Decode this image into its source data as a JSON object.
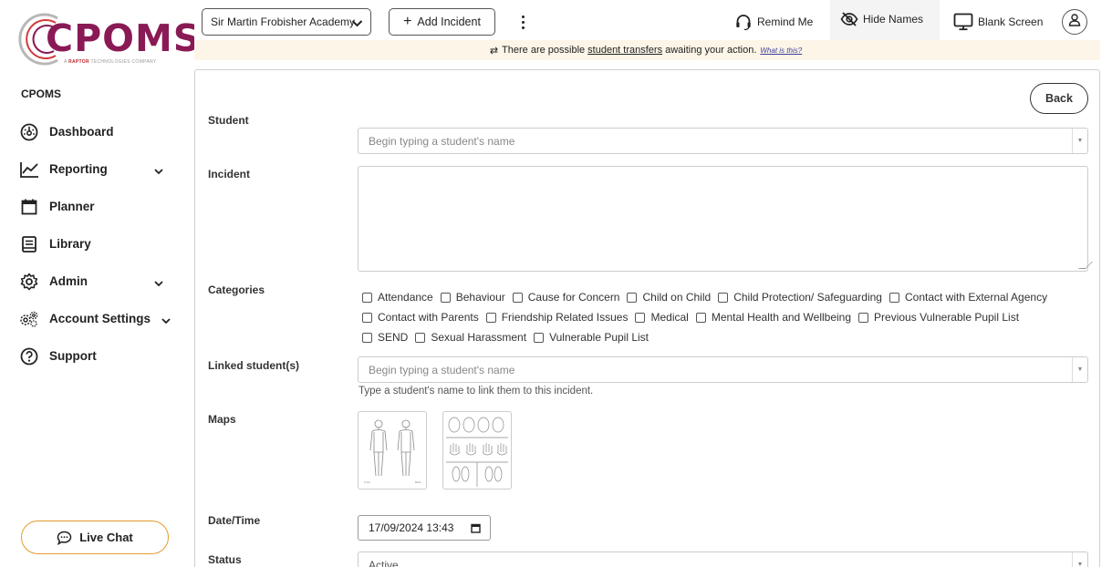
{
  "sidebar": {
    "logo_text": "CPOMS",
    "logo_sub_brand": "RAPTOR",
    "logo_sub_pre": "A ",
    "logo_sub_post": " TECHNOLOGIES COMPANY",
    "heading": "CPOMS",
    "items": [
      {
        "label": "Dashboard",
        "icon": "dashboard-icon",
        "has_chevron": false
      },
      {
        "label": "Reporting",
        "icon": "chart-line-icon",
        "has_chevron": true
      },
      {
        "label": "Planner",
        "icon": "calendar-icon",
        "has_chevron": false
      },
      {
        "label": "Library",
        "icon": "book-icon",
        "has_chevron": false
      },
      {
        "label": "Admin",
        "icon": "gear-icon",
        "has_chevron": true
      },
      {
        "label": "Account Settings",
        "icon": "gears-icon",
        "has_chevron": true
      },
      {
        "label": "Support",
        "icon": "question-icon",
        "has_chevron": false
      }
    ],
    "live_chat_label": "Live Chat"
  },
  "topbar": {
    "school": "Sir Martin Frobisher Academy",
    "add_incident": "Add Incident",
    "remind_me": "Remind Me",
    "hide_names": "Hide Names",
    "blank_screen": "Blank Screen"
  },
  "notice": {
    "pre": "There are possible",
    "link": "student transfers",
    "post": "awaiting your action.",
    "what": "What is this?"
  },
  "form": {
    "back": "Back",
    "student_label": "Student",
    "student_placeholder": "Begin typing a student's name",
    "incident_label": "Incident",
    "incident_value": "",
    "categories_label": "Categories",
    "categories": [
      [
        "Attendance",
        "Behaviour",
        "Cause for Concern",
        "Child on Child",
        "Child Protection/ Safeguarding",
        "Contact with External Agency"
      ],
      [
        "Contact with Parents",
        "Friendship Related Issues",
        "Medical",
        "Mental Health and Wellbeing",
        "Previous Vulnerable Pupil List"
      ],
      [
        "SEND",
        "Sexual Harassment",
        "Vulnerable Pupil List"
      ]
    ],
    "linked_label": "Linked student(s)",
    "linked_placeholder": "Begin typing a student's name",
    "linked_help": "Type a student's name to link them to this incident.",
    "maps_label": "Maps",
    "datetime_label": "Date/Time",
    "datetime_value": "17/09/2024 13:43",
    "status_label": "Status",
    "status_value": "Active"
  },
  "colors": {
    "brand": "#8a1a55",
    "live_chat_border": "#e39b2c",
    "notice_bg": "#fdf6e8"
  }
}
